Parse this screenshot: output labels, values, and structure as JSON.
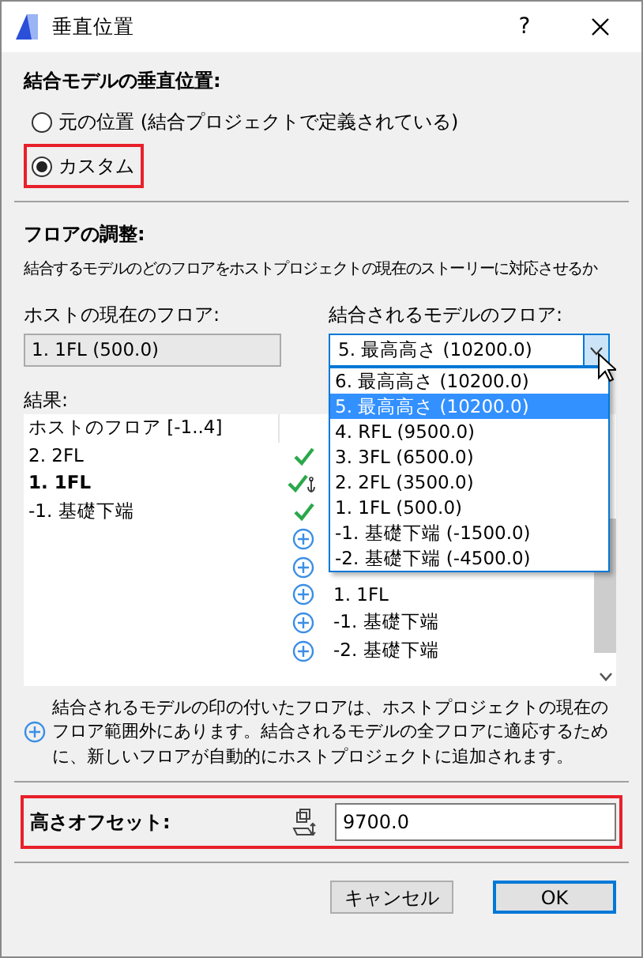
{
  "window": {
    "title": "垂直位置",
    "help": "?"
  },
  "vertical_position": {
    "heading": "結合モデルの垂直位置:",
    "options": [
      {
        "label": "元の位置 (結合プロジェクトで定義されている)",
        "selected": false,
        "highlighted": false
      },
      {
        "label": "カスタム",
        "selected": true,
        "highlighted": true
      }
    ]
  },
  "floor_adjustment": {
    "heading": "フロアの調整:",
    "description": "結合するモデルのどのフロアをホストプロジェクトの現在のストーリーに対応させるか",
    "host_floor": {
      "label": "ホストの現在のフロア:",
      "value": "1. 1FL (500.0)"
    },
    "merged_floor": {
      "label": "結合されるモデルのフロア:",
      "value": "5. 最高高さ (10200.0)",
      "expanded": true,
      "options": [
        {
          "label": "6. 最高高さ (10200.0)",
          "selected": false
        },
        {
          "label": "5. 最高高さ (10200.0)",
          "selected": true
        },
        {
          "label": "4. RFL (9500.0)",
          "selected": false
        },
        {
          "label": "3. 3FL (6500.0)",
          "selected": false
        },
        {
          "label": "2. 2FL (3500.0)",
          "selected": false
        },
        {
          "label": "1. 1FL (500.0)",
          "selected": false
        },
        {
          "label": "-1. 基礎下端 (-1500.0)",
          "selected": false
        },
        {
          "label": "-2. 基礎下端 (-4500.0)",
          "selected": false
        }
      ]
    },
    "result": {
      "label": "結果:",
      "header": "ホストのフロア [-1..4]",
      "rows": [
        {
          "host": "2. 2FL",
          "kind": "check",
          "bold": false
        },
        {
          "host": "1. 1FL",
          "kind": "check-anchor",
          "bold": true
        },
        {
          "host": "-1. 基礎下端",
          "kind": "check",
          "bold": false
        },
        {
          "kind": "plus"
        },
        {
          "kind": "plus"
        },
        {
          "kind": "plus",
          "merged": "1. 1FL"
        },
        {
          "kind": "plus",
          "merged": "-1. 基礎下端"
        },
        {
          "kind": "plus",
          "merged": "-2. 基礎下端"
        }
      ]
    }
  },
  "note": "結合されるモデルの印の付いたフロアは、ホストプロジェクトの現在のフロア範囲外にあります。結合されるモデルの全フロアに適応するために、新しいフロアが自動的にホストプロジェクトに追加されます。",
  "offset": {
    "label": "高さオフセット:",
    "value": "9700.0",
    "highlighted": true
  },
  "buttons": [
    {
      "label": "キャンセル",
      "default": false
    },
    {
      "label": "OK",
      "default": true
    }
  ]
}
